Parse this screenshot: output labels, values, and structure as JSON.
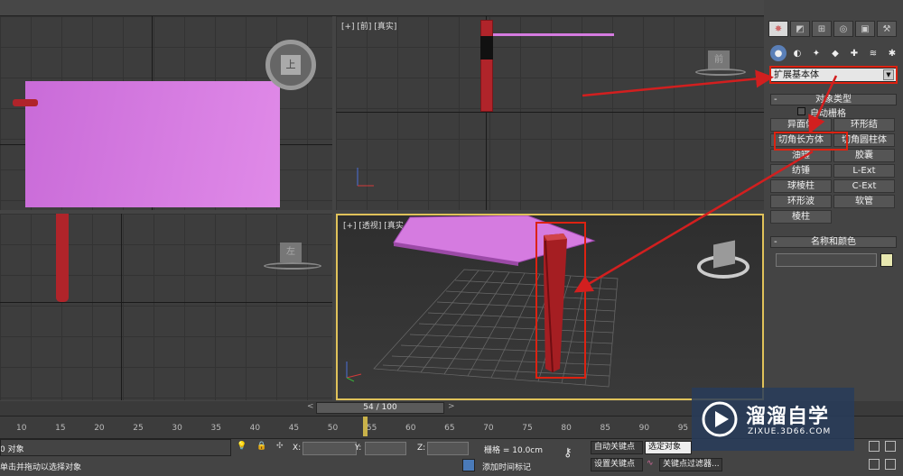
{
  "viewports": {
    "front_label": "[+] [前] [真实]",
    "perspective_label": "[+] [透视] [真实 + 边面]",
    "top_cube_text": "上",
    "front_cube_text": "前",
    "left_cube_text": "左"
  },
  "command_panel": {
    "category_value": "扩展基本体",
    "object_type_title": "对象类型",
    "autogrid_label": "自动栅格",
    "buttons": [
      "异面体",
      "环形结",
      "切角长方体",
      "切角圆柱体",
      "油罐",
      "胶囊",
      "纺锤",
      "L-Ext",
      "球棱柱",
      "C-Ext",
      "环形波",
      "软管",
      "棱柱"
    ],
    "name_color_title": "名称和颜色",
    "color_swatch": "#e8e8b0"
  },
  "timeline": {
    "frame_display": "54 / 100",
    "ticks": [
      "10",
      "15",
      "20",
      "25",
      "30",
      "35",
      "40",
      "45",
      "50",
      "55",
      "60",
      "65",
      "70",
      "75",
      "80",
      "85",
      "90",
      "95"
    ]
  },
  "status_bar": {
    "selected_text": "0 对象",
    "prompt_text": "单击并拖动以选择对象",
    "x_label": "X:",
    "y_label": "Y:",
    "z_label": "Z:",
    "grid_text": "栅格 = 10.0cm",
    "auto_key": "自动关键点",
    "selected_obj": "选定对象",
    "set_key": "设置关键点",
    "key_filter": "关键点过滤器...",
    "add_time_tag": "添加时间标记"
  },
  "watermark": {
    "title": "溜溜自学",
    "sub": "ZIXUE.3D66.COM"
  },
  "colors": {
    "accent_red": "#d21f1f",
    "slab_pink": "#d57be0",
    "leg_red": "#a51e22"
  }
}
